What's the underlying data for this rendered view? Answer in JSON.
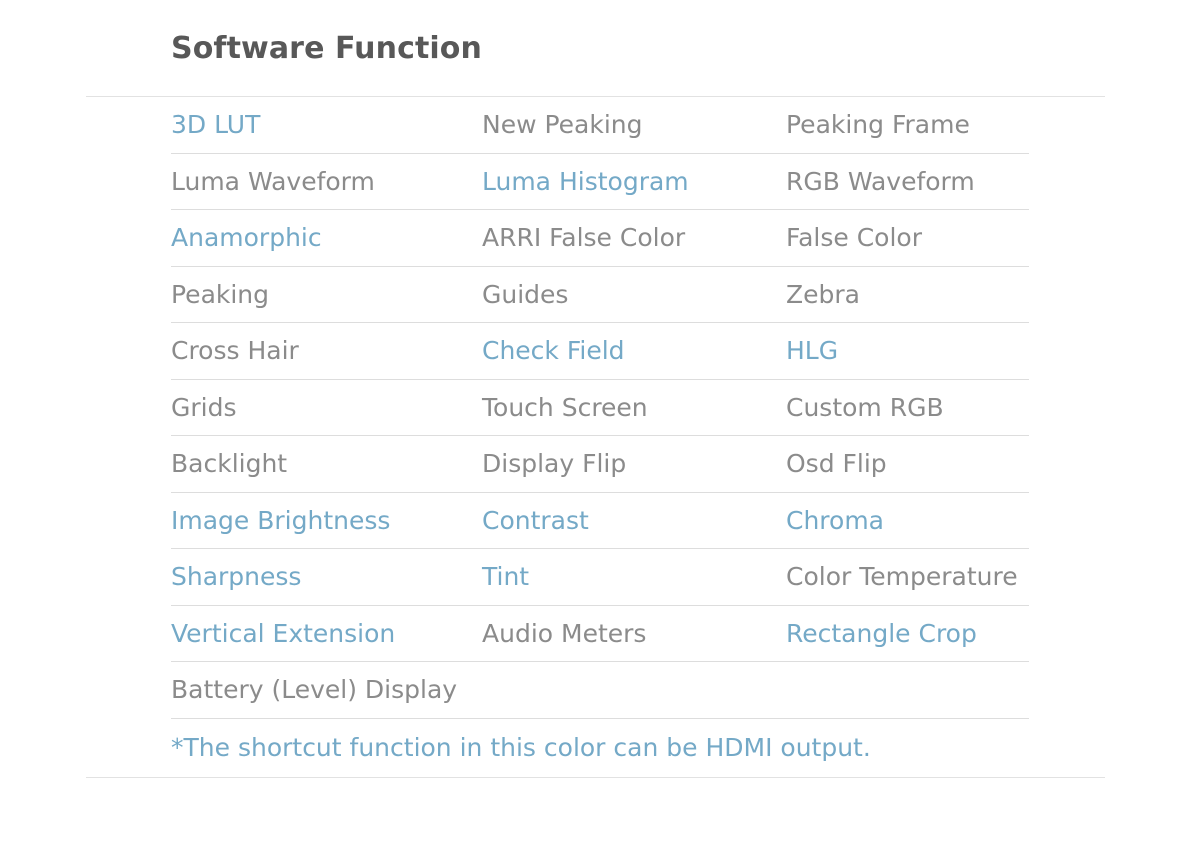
{
  "header": {
    "title": "Software Function"
  },
  "colors": {
    "accent_blue": "#74a9c7",
    "body_gray": "#8b8b8b",
    "title_gray": "#585858",
    "divider": "#dddddd",
    "outer_rule": "#e2e2e2",
    "background": "#ffffff"
  },
  "table": {
    "columns": 3,
    "rows": [
      [
        {
          "label": "3D LUT",
          "highlight": true
        },
        {
          "label": "New Peaking",
          "highlight": false
        },
        {
          "label": "Peaking Frame",
          "highlight": false
        }
      ],
      [
        {
          "label": "Luma Waveform",
          "highlight": false
        },
        {
          "label": "Luma Histogram",
          "highlight": true
        },
        {
          "label": "RGB Waveform",
          "highlight": false
        }
      ],
      [
        {
          "label": "Anamorphic",
          "highlight": true
        },
        {
          "label": "ARRI False Color",
          "highlight": false
        },
        {
          "label": "False Color",
          "highlight": false
        }
      ],
      [
        {
          "label": "Peaking",
          "highlight": false
        },
        {
          "label": "Guides",
          "highlight": false
        },
        {
          "label": "Zebra",
          "highlight": false
        }
      ],
      [
        {
          "label": "Cross Hair",
          "highlight": false
        },
        {
          "label": "Check Field",
          "highlight": true
        },
        {
          "label": "HLG",
          "highlight": true
        }
      ],
      [
        {
          "label": "Grids",
          "highlight": false
        },
        {
          "label": "Touch Screen",
          "highlight": false
        },
        {
          "label": "Custom RGB",
          "highlight": false
        }
      ],
      [
        {
          "label": "Backlight",
          "highlight": false
        },
        {
          "label": "Display Flip",
          "highlight": false
        },
        {
          "label": "Osd Flip",
          "highlight": false
        }
      ],
      [
        {
          "label": "Image Brightness",
          "highlight": true
        },
        {
          "label": "Contrast",
          "highlight": true
        },
        {
          "label": "Chroma",
          "highlight": true
        }
      ],
      [
        {
          "label": "Sharpness",
          "highlight": true
        },
        {
          "label": "Tint",
          "highlight": true
        },
        {
          "label": "Color Temperature",
          "highlight": false
        }
      ],
      [
        {
          "label": "Vertical Extension",
          "highlight": true
        },
        {
          "label": "Audio Meters",
          "highlight": false
        },
        {
          "label": "Rectangle Crop",
          "highlight": true
        }
      ],
      [
        {
          "label": "Battery (Level) Display",
          "highlight": false
        },
        {
          "label": "",
          "highlight": false
        },
        {
          "label": "",
          "highlight": false
        }
      ]
    ]
  },
  "footnote": {
    "text": "*The shortcut function in this color can be HDMI output."
  }
}
